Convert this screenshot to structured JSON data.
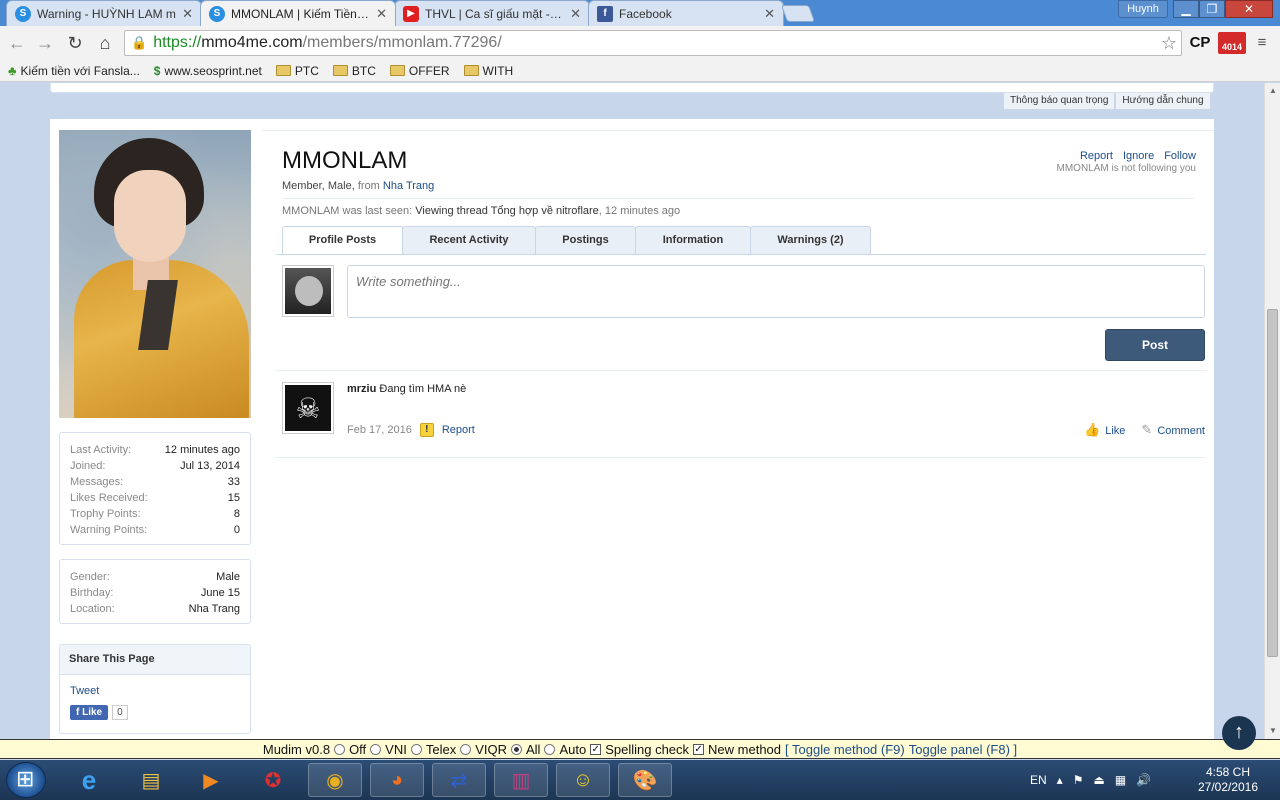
{
  "browser": {
    "tabs": [
      {
        "label": "Warning - HUỲNH LAM m",
        "icon": "seosprint-icon",
        "color": "#2a8fe0",
        "active": false
      },
      {
        "label": "MMONLAM | Kiếm Tiền Tr",
        "icon": "seosprint-icon",
        "color": "#2a8fe0",
        "active": true
      },
      {
        "label": "THVL | Ca sĩ giấu mặt - Tập",
        "icon": "youtube-icon",
        "color": "#e02020",
        "active": false
      },
      {
        "label": "Facebook",
        "icon": "facebook-icon",
        "color": "#3b5998",
        "active": false
      }
    ],
    "user": "Huynh",
    "url": {
      "scheme": "https://",
      "host": "mmo4me.com",
      "path": "/members/mmonlam.77296/"
    },
    "extensions": {
      "cp": "CP",
      "badge": "4014"
    },
    "bookmarks": [
      {
        "label": "Kiếm tiền với Fansla...",
        "icon": "leaf-icon"
      },
      {
        "label": "www.seosprint.net",
        "icon": "seosprint-icon"
      },
      {
        "label": "PTC",
        "icon": "folder-icon"
      },
      {
        "label": "BTC",
        "icon": "folder-icon"
      },
      {
        "label": "OFFER",
        "icon": "folder-icon"
      },
      {
        "label": "WITH",
        "icon": "folder-icon"
      }
    ]
  },
  "notices": {
    "important": "Thông báo quan trọng",
    "guide": "Hướng dẫn chung"
  },
  "profile": {
    "name": "MMONLAM",
    "info": {
      "role": "Member",
      "gender": "Male",
      "from_label": "from",
      "location": "Nha Trang"
    },
    "actions": {
      "report": "Report",
      "ignore": "Ignore",
      "follow": "Follow",
      "follow_status": "MMONLAM is not following you"
    },
    "last_seen": {
      "prefix": "MMONLAM was last seen:",
      "activity": "Viewing thread Tổng hợp về nitroflare",
      "time": ", 12 minutes ago"
    },
    "tabs": [
      "Profile Posts",
      "Recent Activity",
      "Postings",
      "Information",
      "Warnings (2)"
    ],
    "status_placeholder": "Write something...",
    "post_button": "Post"
  },
  "stats": [
    {
      "label": "Last Activity:",
      "value": "12 minutes ago"
    },
    {
      "label": "Joined:",
      "value": "Jul 13, 2014"
    },
    {
      "label": "Messages:",
      "value": "33"
    },
    {
      "label": "Likes Received:",
      "value": "15"
    },
    {
      "label": "Trophy Points:",
      "value": "8"
    },
    {
      "label": "Warning Points:",
      "value": "0"
    }
  ],
  "personal": [
    {
      "label": "Gender:",
      "value": "Male"
    },
    {
      "label": "Birthday:",
      "value": "June 15"
    },
    {
      "label": "Location:",
      "value": "Nha Trang"
    }
  ],
  "share": {
    "title": "Share This Page",
    "tweet": "Tweet",
    "like": "Like",
    "count": "0"
  },
  "post": {
    "author": "mrziu",
    "text": "Đang tìm HMA nè",
    "date": "Feb 17, 2016",
    "report": "Report",
    "like": "Like",
    "comment": "Comment"
  },
  "mudim": {
    "version": "Mudim v0.8",
    "modes": [
      "Off",
      "VNI",
      "Telex",
      "VIQR",
      "All",
      "Auto"
    ],
    "selected": "All",
    "spelling": "Spelling check",
    "new_method": "New method",
    "toggle_method": "[ Toggle method (F9)",
    "toggle_panel": "Toggle panel (F8) ]"
  },
  "taskbar": {
    "lang": "EN",
    "time": "4:58 CH",
    "date": "27/02/2016",
    "apps": [
      "internet-explorer-icon",
      "file-explorer-icon",
      "media-player-icon",
      "game-icon",
      "chrome-icon",
      "firefox-icon",
      "teamviewer-icon",
      "winrar-icon",
      "yahoo-messenger-icon",
      "paint-icon"
    ]
  }
}
